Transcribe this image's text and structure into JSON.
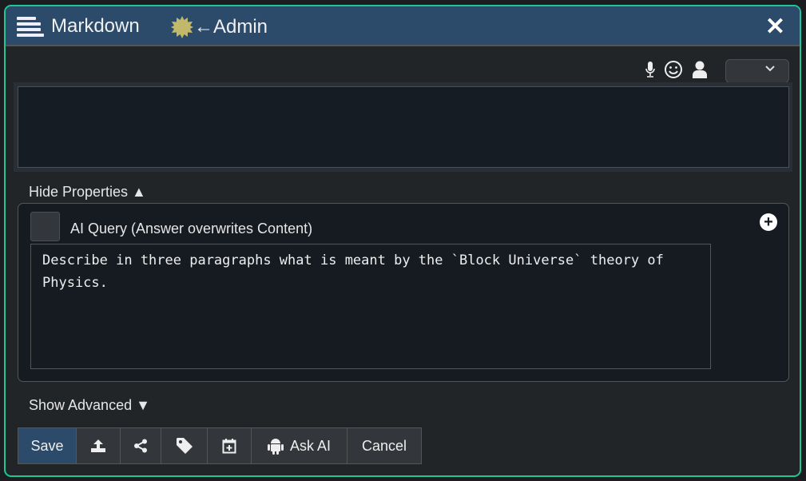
{
  "header": {
    "title": "Markdown",
    "admin": "←Admin",
    "sun_color": "#c2b86c"
  },
  "toolbar": {
    "select_value": ""
  },
  "editor": {
    "content": ""
  },
  "properties": {
    "toggle_label": "Hide Properties ▲",
    "ai_query_label": "AI Query (Answer overwrites Content)",
    "ai_query_checked": false,
    "query_text": "Describe in three paragraphs what is meant by the `Block Universe` theory of Physics."
  },
  "advanced": {
    "toggle_label": "Show Advanced ▼"
  },
  "buttons": {
    "save": "Save",
    "ask_ai": "Ask AI",
    "cancel": "Cancel"
  }
}
